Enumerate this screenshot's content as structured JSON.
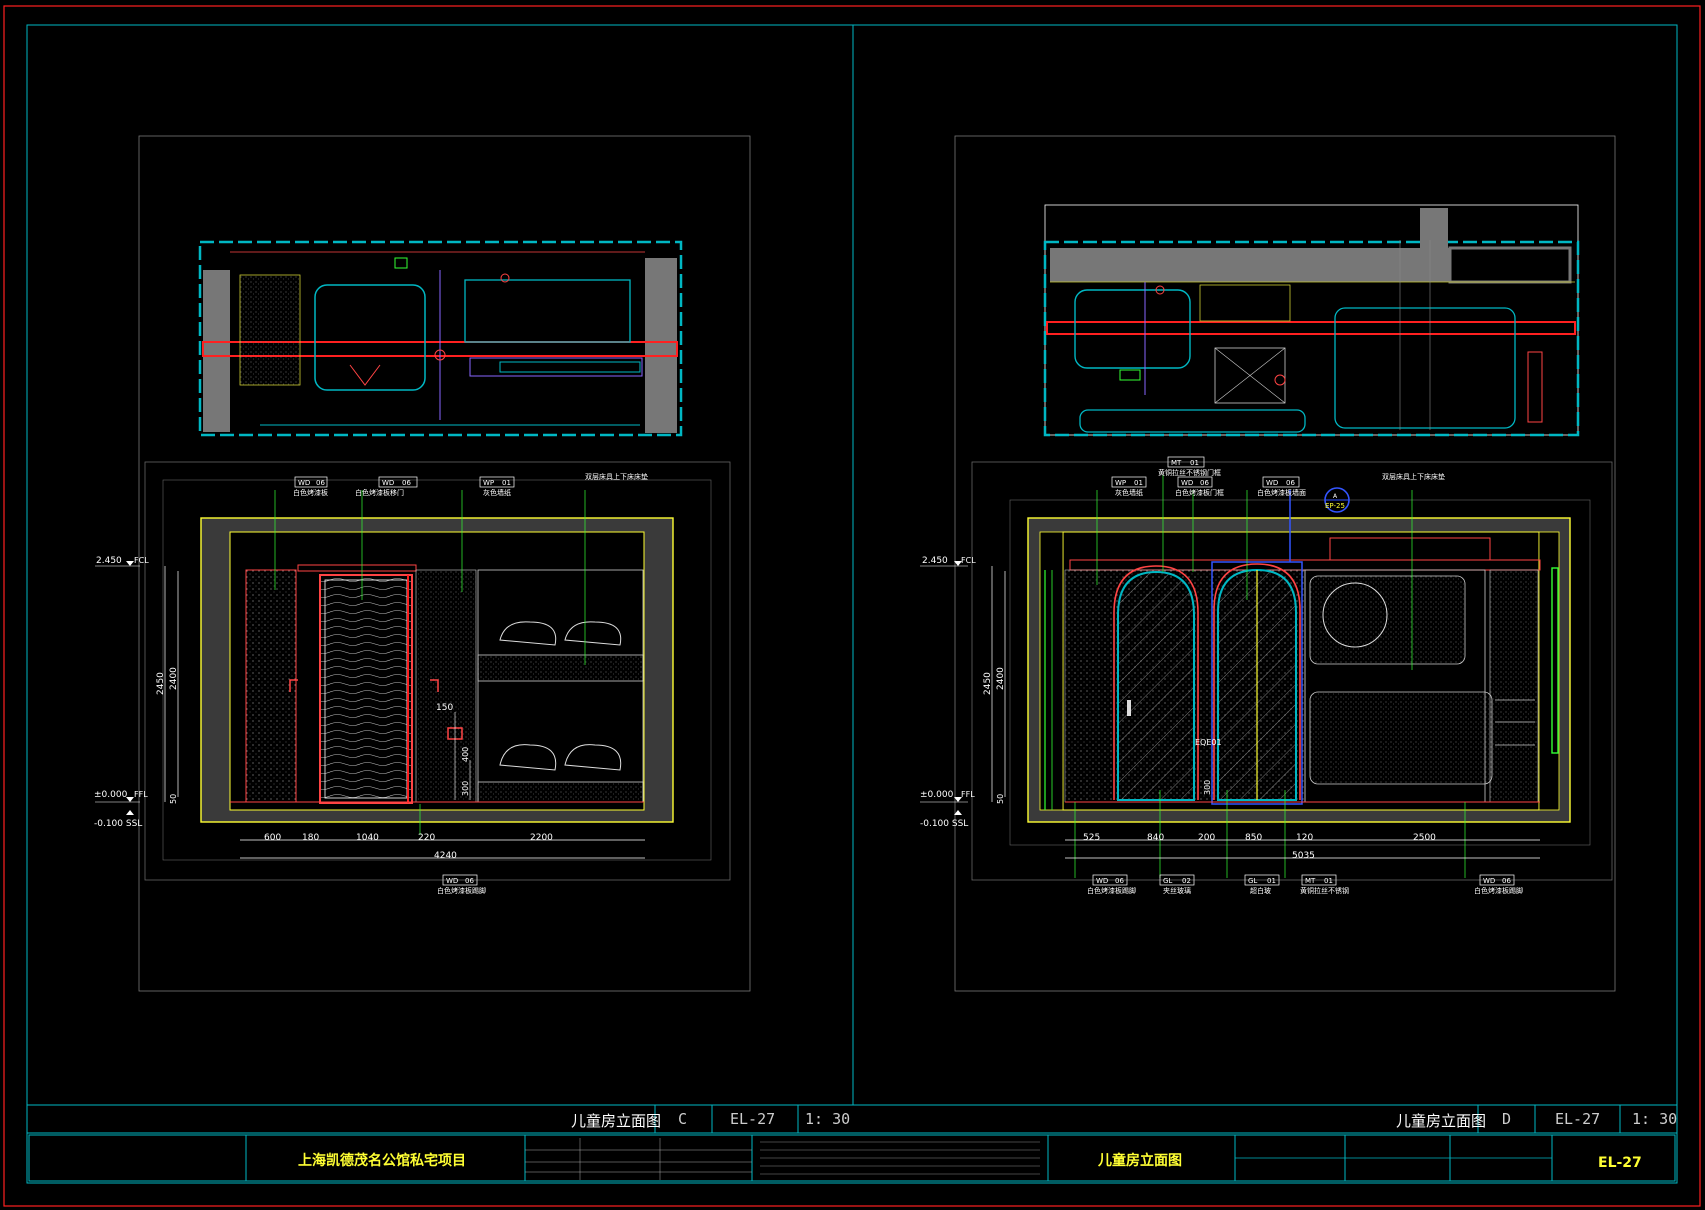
{
  "colors": {
    "background": "#000000",
    "frame_red": "#ff2020",
    "frame_cyan": "#00b7c3",
    "yellow": "#ffff33",
    "green": "#33ff33",
    "magenta": "#ff33ff",
    "white": "#ffffff",
    "grey": "#808080"
  },
  "left_elevation": {
    "level_top": "2.450",
    "level_top_tag": "FCL",
    "level_floor": "±0.000",
    "level_floor_tag": "FFL",
    "level_ssl": "-0.100 SSL",
    "height_total": "2450",
    "height_inner": "2400",
    "dim_150": "150",
    "dim_400": "400",
    "dim_300": "300",
    "dim_50": "50",
    "widths": [
      "600",
      "180",
      "1040",
      "220",
      "2200"
    ],
    "total_width": "4240",
    "callouts": [
      {
        "code": "WD",
        "num": "06",
        "label": "白色烤漆板"
      },
      {
        "code": "WD",
        "num": "06",
        "label": "白色烤漆板移门"
      },
      {
        "code": "WP",
        "num": "01",
        "label": "灰色墙纸"
      },
      {
        "code": "",
        "num": "",
        "label": "双层床具上下床床垫"
      }
    ],
    "bottom_callout": {
      "code": "WD",
      "num": "06",
      "label": "白色烤漆板踢脚"
    }
  },
  "right_elevation": {
    "level_top": "2.450",
    "level_top_tag": "FCL",
    "level_floor": "±0.000",
    "level_floor_tag": "FFL",
    "level_ssl": "-0.100 SSL",
    "height_total": "2450",
    "height_inner": "2400",
    "dim_300": "300",
    "dim_50": "50",
    "widths": [
      "525",
      "840",
      "200",
      "850",
      "120",
      "2500"
    ],
    "total_width": "5035",
    "callouts": [
      {
        "code": "MT",
        "num": "01",
        "label": "黄铜拉丝不锈钢门框"
      },
      {
        "code": "WP",
        "num": "01",
        "label": "灰色墙纸"
      },
      {
        "code": "WD",
        "num": "06",
        "label": "白色烤漆板门框"
      },
      {
        "code": "WD",
        "num": "06",
        "label": "白色烤漆板墙面"
      },
      {
        "code": "",
        "num": "",
        "label": "双层床具上下床床垫"
      }
    ],
    "section_mark": {
      "letter": "A",
      "sheet": "EP-25"
    },
    "eq_tag": "EQE01",
    "bottom_callouts": [
      {
        "code": "WD",
        "num": "06",
        "label": "白色烤漆板踢脚"
      },
      {
        "code": "GL",
        "num": "02",
        "label": "夹丝玻璃"
      },
      {
        "code": "GL",
        "num": "01",
        "label": "超白玻"
      },
      {
        "code": "MT",
        "num": "01",
        "label": "黄铜拉丝不锈钢"
      },
      {
        "code": "WD",
        "num": "06",
        "label": "白色烤漆板踢脚"
      }
    ]
  },
  "title_bar": {
    "left": {
      "name": "儿童房立面图",
      "view": "C",
      "sheet": "EL-27",
      "scale": "1: 30"
    },
    "right": {
      "name": "儿童房立面图",
      "view": "D",
      "sheet": "EL-27",
      "scale": "1: 30"
    }
  },
  "title_block": {
    "project_name": "上海凯德茂名公馆私宅项目",
    "drawing_title": "儿童房立面图",
    "sheet_no": "EL-27"
  }
}
